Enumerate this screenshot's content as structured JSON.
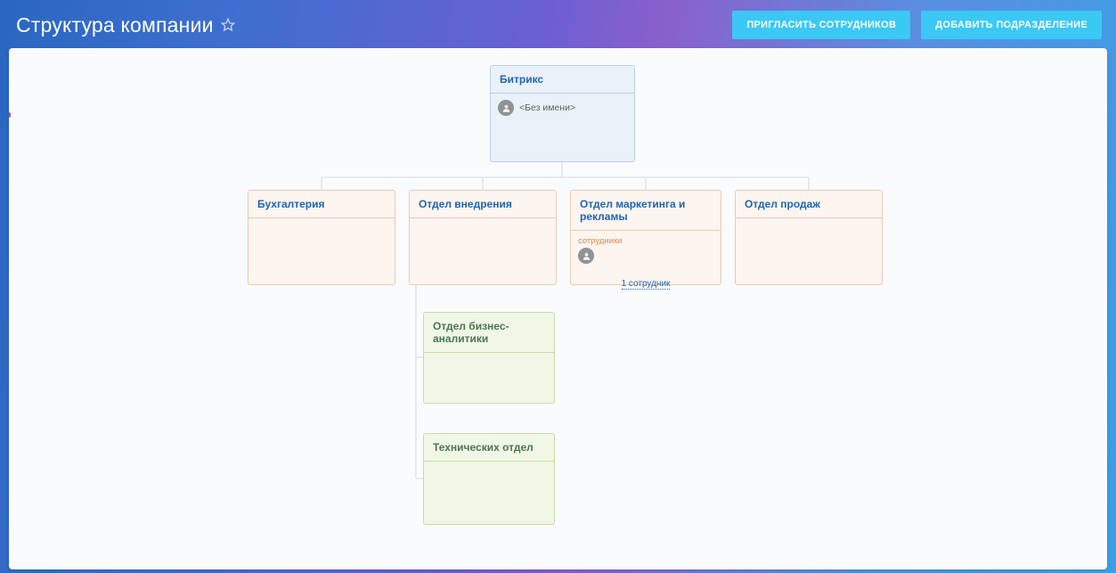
{
  "page": {
    "title": "Структура компании"
  },
  "buttons": {
    "invite": "ПРИГЛАСИТЬ СОТРУДНИКОВ",
    "add_dept": "ДОБАВИТЬ ПОДРАЗДЕЛЕНИЕ"
  },
  "org": {
    "root": {
      "name": "Битрикс",
      "manager": "<Без имени>"
    },
    "level1": [
      {
        "name": "Бухгалтерия"
      },
      {
        "name": "Отдел внедрения"
      },
      {
        "name": "Отдел маркетинга и рекламы",
        "employees_label": "сотрудники",
        "count_text": "1 сотрудник"
      },
      {
        "name": "Отдел продаж"
      }
    ],
    "level2": [
      {
        "name": "Отдел бизнес-аналитики"
      },
      {
        "name": "Технических отдел"
      }
    ]
  }
}
